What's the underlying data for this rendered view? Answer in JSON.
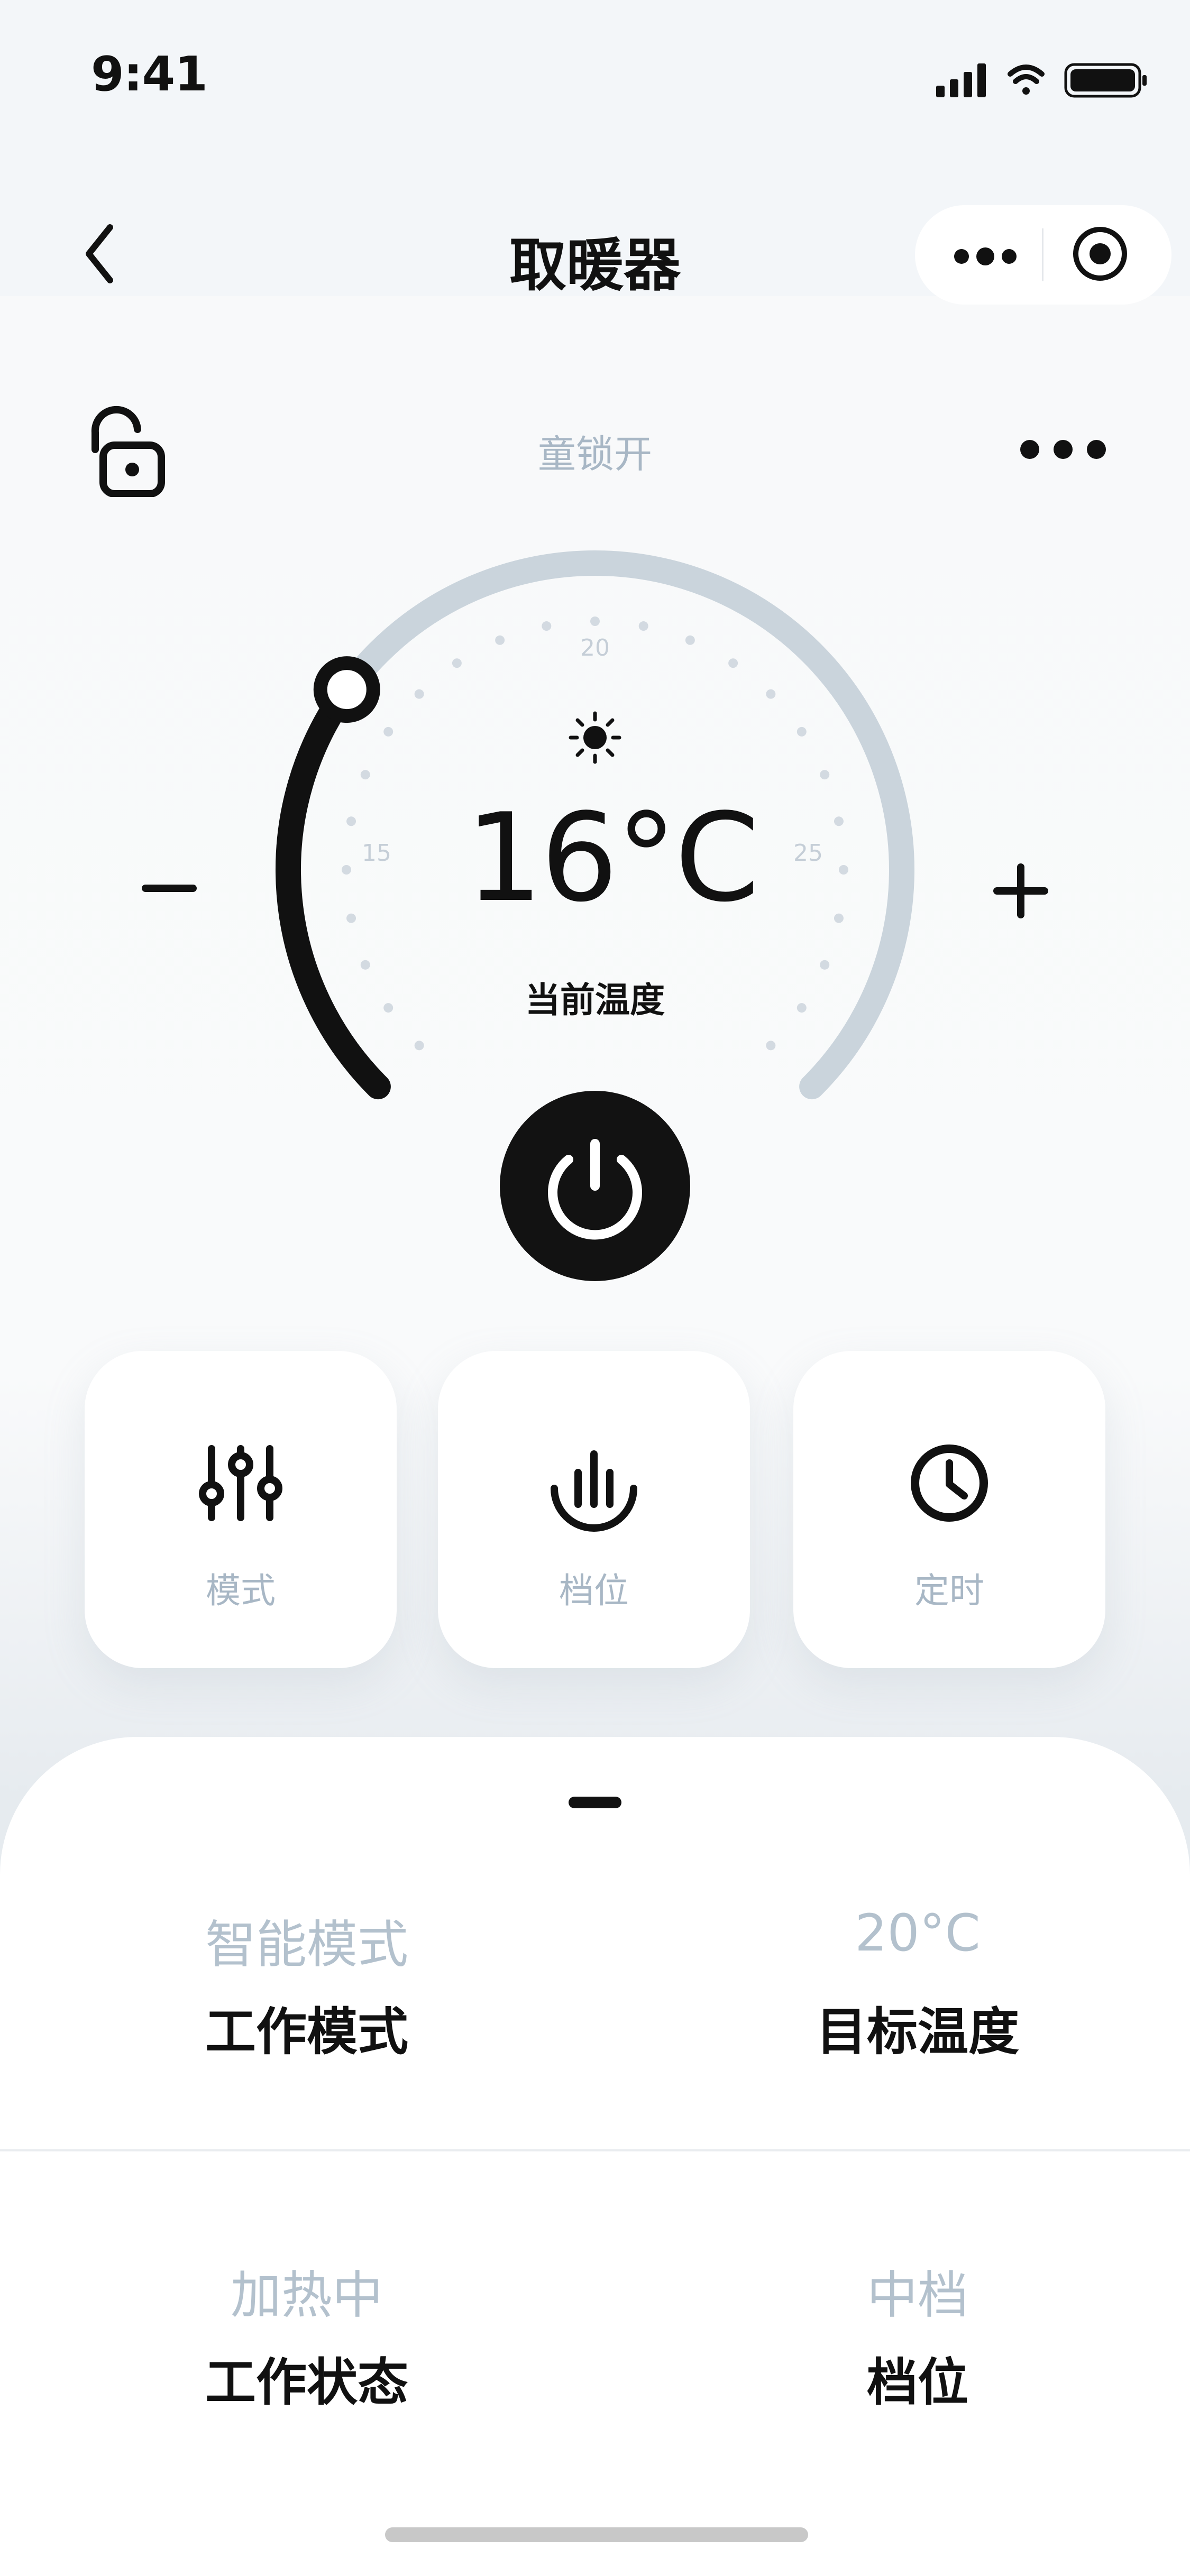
{
  "status_bar": {
    "time": "9:41"
  },
  "nav": {
    "title": "取暖器",
    "back_icon": "chevron-left-icon",
    "more_icon": "more-dots-icon",
    "target_icon": "target-icon"
  },
  "lock": {
    "label": "童锁开",
    "icon": "unlock-icon",
    "more_icon": "more-dots-icon"
  },
  "thermostat": {
    "value": "16°C",
    "label": "当前温度",
    "tick_labels": [
      "15",
      "20",
      "25"
    ],
    "minus_label": "–",
    "plus_label": "+",
    "current_temp": 16,
    "range": [
      10,
      30
    ],
    "track_color": "#cad4dc",
    "progress_color": "#111111"
  },
  "controls": [
    {
      "label": "模式",
      "icon": "sliders-icon"
    },
    {
      "label": "档位",
      "icon": "fire-level-icon"
    },
    {
      "label": "定时",
      "icon": "clock-icon"
    }
  ],
  "info": {
    "mode": {
      "value": "智能模式",
      "key": "工作模式"
    },
    "target": {
      "value": "20°C",
      "key": "目标温度"
    },
    "status": {
      "value": "加热中",
      "key": "工作状态"
    },
    "level": {
      "value": "中档",
      "key": "档位"
    }
  }
}
